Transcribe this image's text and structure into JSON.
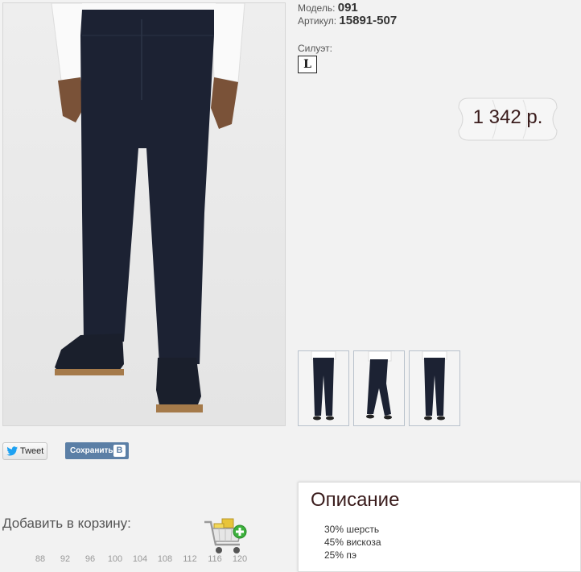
{
  "product": {
    "model_label": "Модель:",
    "model_value": "091",
    "article_label": "Артикул:",
    "article_value": "15891-507",
    "silhouette_label": "Силуэт:",
    "silhouette_badge": "L",
    "price": "1 342 р."
  },
  "colors": {
    "trousers": "#1c2233",
    "shirt": "#ffffff",
    "accent_dark": "#3a1c1c",
    "vk_blue": "#5b7fa6",
    "twitter_blue": "#1da1f2",
    "cart_green": "#3cb03c"
  },
  "social": {
    "tweet_label": "Tweet",
    "tweet_icon": "twitter-bird-icon",
    "vk_label": "Сохранить",
    "vk_icon": "В"
  },
  "cart": {
    "label": "Добавить в корзину:",
    "icon": "shopping-cart-add-icon"
  },
  "sizes": [
    "88",
    "92",
    "96",
    "100",
    "104",
    "108",
    "112",
    "116",
    "120"
  ],
  "description": {
    "title": "Описание",
    "items": [
      "30% шерсть",
      "45% вискоза",
      "25% пэ"
    ]
  }
}
